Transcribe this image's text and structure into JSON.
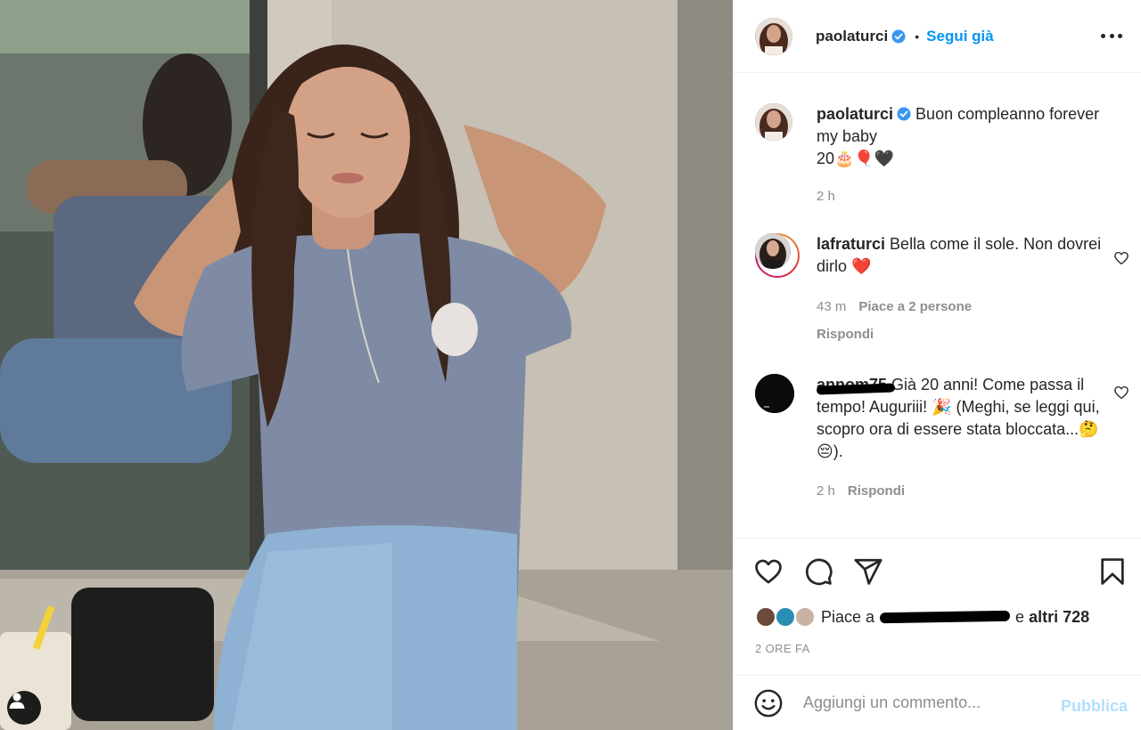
{
  "post": {
    "author": "paolaturci",
    "follow_label": "Segui già",
    "separator": "•",
    "caption": {
      "username": "paolaturci",
      "text_line1": "Buon compleanno forever",
      "text_line2": "my baby",
      "text_line3": "20🎂🎈🖤",
      "time": "2 h"
    }
  },
  "comments": [
    {
      "username": "lafraturci",
      "text": "Bella come il sole. Non dovrei dirlo ❤️",
      "time": "43 m",
      "likes": "Piace a 2 persone",
      "reply": "Rispondi"
    },
    {
      "username": "annom75",
      "text": "Già 20 anni! Come passa il tempo! Auguriii! 🎉 (Meghi, se leggi qui, scopro ora di essere stata bloccata...🤔😔).",
      "time": "2 h",
      "reply": "Rispondi"
    }
  ],
  "likes": {
    "prefix": "Piace a",
    "connector": "e",
    "others": "altri 728"
  },
  "timestamp": "2 ORE FA",
  "composer": {
    "placeholder": "Aggiungi un commento...",
    "publish_label": "Pubblica"
  },
  "icons": {
    "verified": "verified-badge-icon",
    "more": "more-options-icon",
    "like": "heart-icon",
    "comment": "comment-icon",
    "share": "share-icon",
    "save": "bookmark-icon",
    "emoji": "emoji-icon",
    "tag": "user-tag-icon"
  },
  "colors": {
    "accent": "#0095f6",
    "publish_disabled": "#b2dffc",
    "secondary_text": "#8e8e8e",
    "verified": "#3897f0"
  }
}
